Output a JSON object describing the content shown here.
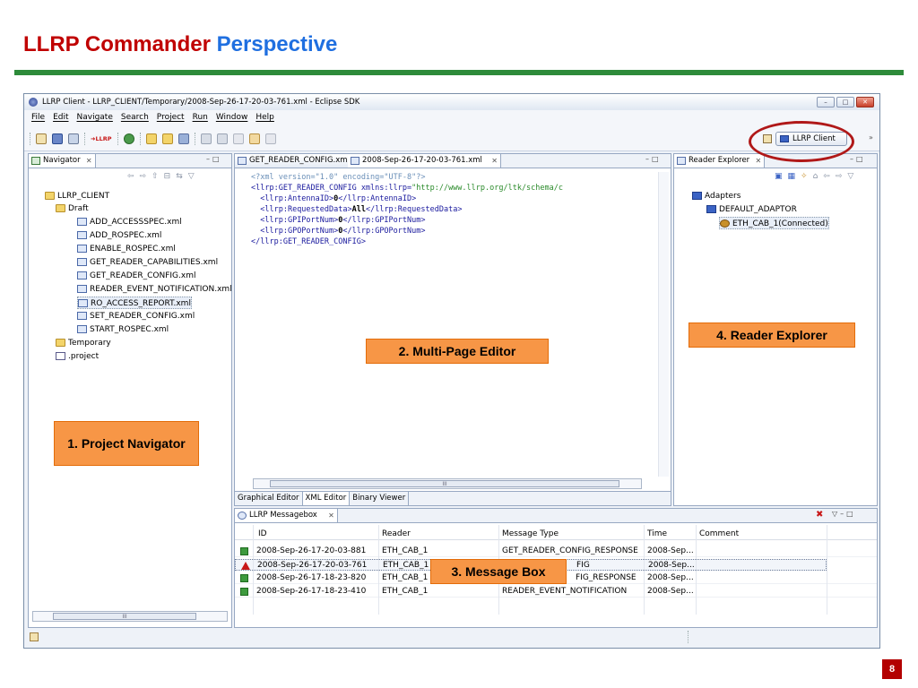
{
  "slide": {
    "title_part1": "LLRP Commander",
    "title_part2": "Perspective",
    "page_number": "8"
  },
  "window": {
    "title": "LLRP Client - LLRP_CLIENT/Temporary/2008-Sep-26-17-20-03-761.xml - Eclipse SDK",
    "buttons": [
      "–",
      "□",
      "✕"
    ]
  },
  "menu": [
    "File",
    "Edit",
    "Navigate",
    "Search",
    "Project",
    "Run",
    "Window",
    "Help"
  ],
  "toolbar": {
    "perspective_label": "LLRP Client",
    "chevron": "»",
    "llrp_button": "LLRP"
  },
  "navigator": {
    "tab_label": "Navigator",
    "tree": [
      {
        "label": "LLRP_CLIENT",
        "level": 0,
        "type": "folder"
      },
      {
        "label": "Draft",
        "level": 1,
        "type": "folder"
      },
      {
        "label": "ADD_ACCESSSPEC.xml",
        "level": 2,
        "type": "xml"
      },
      {
        "label": "ADD_ROSPEC.xml",
        "level": 2,
        "type": "xml"
      },
      {
        "label": "ENABLE_ROSPEC.xml",
        "level": 2,
        "type": "xml"
      },
      {
        "label": "GET_READER_CAPABILITIES.xml",
        "level": 2,
        "type": "xml"
      },
      {
        "label": "GET_READER_CONFIG.xml",
        "level": 2,
        "type": "xml"
      },
      {
        "label": "READER_EVENT_NOTIFICATION.xml",
        "level": 2,
        "type": "xml"
      },
      {
        "label": "RO_ACCESS_REPORT.xml",
        "level": 2,
        "type": "xml",
        "selected": true
      },
      {
        "label": "SET_READER_CONFIG.xml",
        "level": 2,
        "type": "xml"
      },
      {
        "label": "START_ROSPEC.xml",
        "level": 2,
        "type": "xml"
      },
      {
        "label": "Temporary",
        "level": 1,
        "type": "folder"
      },
      {
        "label": ".project",
        "level": 1,
        "type": "project"
      }
    ]
  },
  "editor": {
    "tabs": [
      "GET_READER_CONFIG.xml",
      "2008-Sep-26-17-20-03-761.xml"
    ],
    "code_lines": [
      {
        "decl": "<?xml version=\"1.0\" encoding=\"UTF-8\"?>"
      },
      {
        "tag_open": "<llrp:GET_READER_CONFIG xmlns:llrp=",
        "str": "\"http://www.llrp.org/ltk/schema/c"
      },
      {
        "indent": "  ",
        "tag_open": "<llrp:AntennaID>",
        "val": "0",
        "tag_close": "</llrp:AntennaID>"
      },
      {
        "indent": "  ",
        "tag_open": "<llrp:RequestedData>",
        "val": "All",
        "tag_close": "</llrp:RequestedData>"
      },
      {
        "indent": "  ",
        "tag_open": "<llrp:GPIPortNum>",
        "val": "0",
        "tag_close": "</llrp:GPIPortNum>"
      },
      {
        "indent": "  ",
        "tag_open": "<llrp:GPOPortNum>",
        "val": "0",
        "tag_close": "</llrp:GPOPortNum>"
      },
      {
        "tag_open": "</llrp:GET_READER_CONFIG>"
      }
    ],
    "bottom_tabs": [
      "Graphical Editor",
      "XML Editor",
      "Binary Viewer"
    ],
    "scroll_mark": "III"
  },
  "reader_explorer": {
    "tab_label": "Reader Explorer",
    "tree": [
      {
        "label": "Adapters",
        "level": 0
      },
      {
        "label": "DEFAULT_ADAPTOR",
        "level": 1
      },
      {
        "label": "ETH_CAB_1(Connected)",
        "level": 2,
        "selected": true
      }
    ]
  },
  "messagebox": {
    "tab_label": "LLRP Messagebox",
    "columns": [
      "ID",
      "Reader",
      "Message Type",
      "Time",
      "Comment"
    ],
    "rows": [
      {
        "status": "ok",
        "id": "2008-Sep-26-17-20-03-881",
        "reader": "ETH_CAB_1",
        "type": "GET_READER_CONFIG_RESPONSE",
        "time": "2008-Sep...",
        "comment": ""
      },
      {
        "status": "err",
        "id": "2008-Sep-26-17-20-03-761",
        "reader": "ETH_CAB_1",
        "type": "FIG",
        "time": "2008-Sep...",
        "comment": ""
      },
      {
        "status": "ok",
        "id": "2008-Sep-26-17-18-23-820",
        "reader": "ETH_CAB_1",
        "type": "FIG_RESPONSE",
        "time": "2008-Sep...",
        "comment": ""
      },
      {
        "status": "ok",
        "id": "2008-Sep-26-17-18-23-410",
        "reader": "ETH_CAB_1",
        "type": "READER_EVENT_NOTIFICATION",
        "time": "2008-Sep...",
        "comment": ""
      }
    ]
  },
  "callouts": {
    "navigator": "1. Project Navigator",
    "editor": "2. Multi-Page Editor",
    "messagebox": "3. Message Box",
    "explorer": "4. Reader Explorer"
  },
  "colors": {
    "title_red": "#c00000",
    "title_blue": "#1f6fe0",
    "green_bar": "#2e8b3a",
    "callout_orange": "#f79646",
    "ellipse_red": "#b01818"
  }
}
